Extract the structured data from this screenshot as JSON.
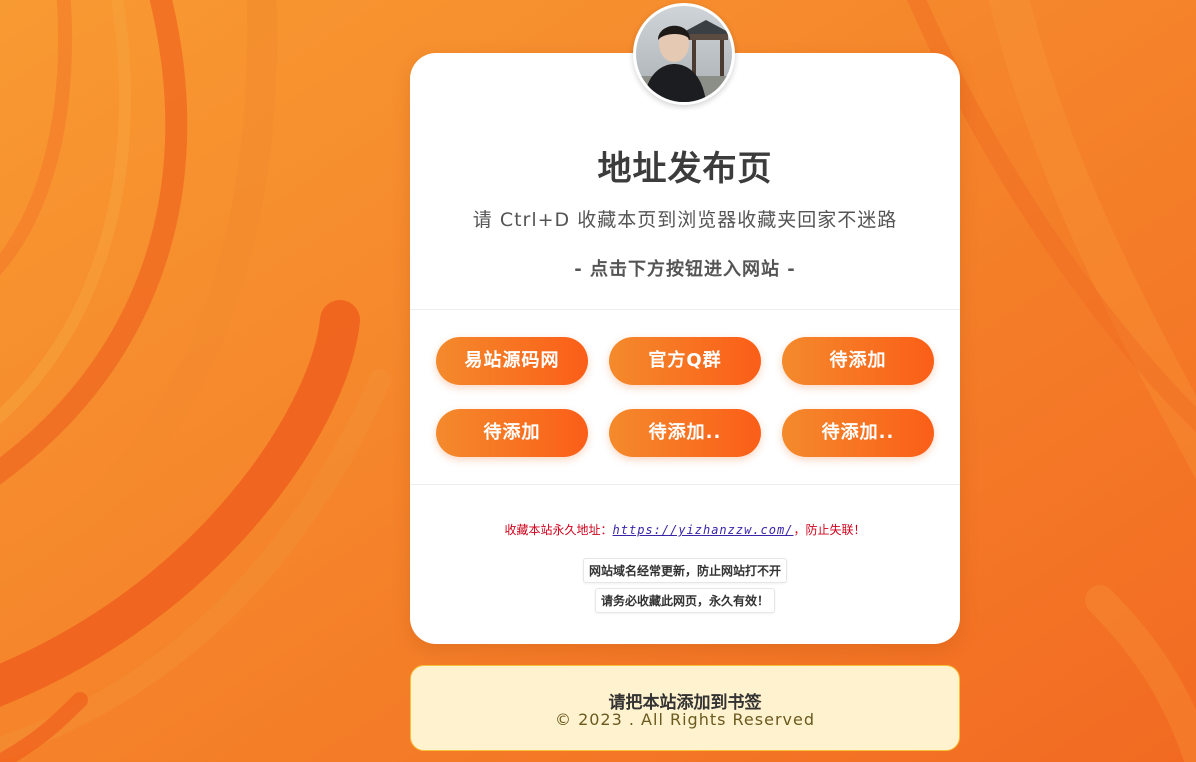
{
  "page": {
    "title": "地址发布页",
    "subtitle": "请 Ctrl+D 收藏本页到浏览器收藏夹回家不迷路",
    "hint": "- 点击下方按钮进入网站 -"
  },
  "colors": {
    "background": "#f57f2a",
    "button_start": "#f48a2c",
    "button_end": "#fb5e18",
    "link_red": "#d0021b",
    "footer_bg": "#fff2cf"
  },
  "avatar": {
    "icon": "user-photo"
  },
  "buttons": [
    {
      "label": "易站源码网"
    },
    {
      "label": "官方Q群"
    },
    {
      "label": "待添加"
    },
    {
      "label": "待添加"
    },
    {
      "label": "待添加.."
    },
    {
      "label": "待添加.."
    }
  ],
  "permanent": {
    "prefix": "收藏本站永久地址：",
    "url": "https://yizhanzzw.com/",
    "suffix": "，防止失联！"
  },
  "notices": [
    "网站域名经常更新，防止网站打不开",
    "请务必收藏此网页，永久有效！"
  ],
  "footer": {
    "title": "请把本站添加到书签",
    "copyright": "© 2023 . All Rights Reserved"
  }
}
